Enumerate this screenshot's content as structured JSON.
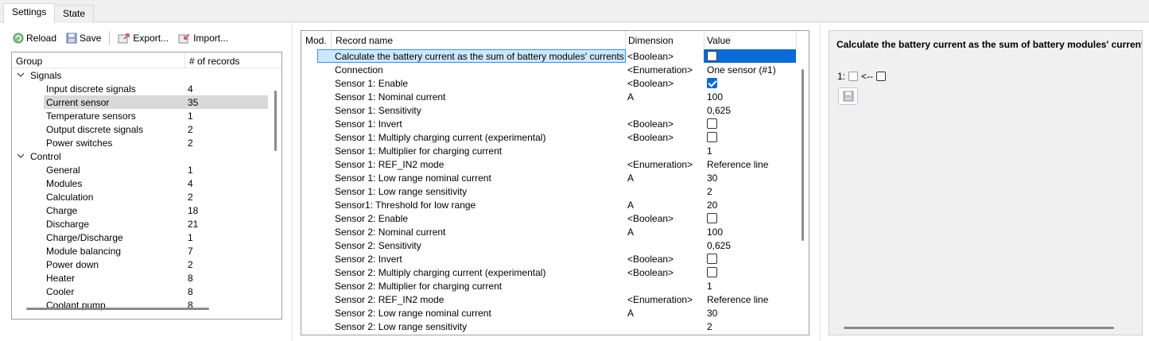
{
  "tabs": [
    {
      "label": "Settings"
    },
    {
      "label": "State"
    }
  ],
  "toolbar": {
    "reload_label": "Reload",
    "save_label": "Save",
    "export_label": "Export...",
    "import_label": "Import..."
  },
  "groups": {
    "header_group": "Group",
    "header_count": "# of records",
    "sections": [
      {
        "label": "Signals",
        "items": [
          {
            "label": "Input discrete signals",
            "count": "4"
          },
          {
            "label": "Current sensor",
            "count": "35",
            "selected": true
          },
          {
            "label": "Temperature sensors",
            "count": "1"
          },
          {
            "label": "Output discrete signals",
            "count": "2"
          },
          {
            "label": "Power switches",
            "count": "2"
          }
        ]
      },
      {
        "label": "Control",
        "items": [
          {
            "label": "General",
            "count": "1"
          },
          {
            "label": "Modules",
            "count": "4"
          },
          {
            "label": "Calculation",
            "count": "2"
          },
          {
            "label": "Charge",
            "count": "18"
          },
          {
            "label": "Discharge",
            "count": "21"
          },
          {
            "label": "Charge/Discharge",
            "count": "1"
          },
          {
            "label": "Module balancing",
            "count": "7"
          },
          {
            "label": "Power down",
            "count": "2"
          },
          {
            "label": "Heater",
            "count": "8"
          },
          {
            "label": "Cooler",
            "count": "8"
          },
          {
            "label": "Coolant pump",
            "count": "8"
          }
        ]
      }
    ]
  },
  "records": {
    "headers": {
      "mod": "Mod.",
      "name": "Record name",
      "dimension": "Dimension",
      "value": "Value"
    },
    "rows": [
      {
        "name": "Calculate the battery current as the sum of battery modules' currents",
        "dim": "<Boolean>",
        "type": "checkbox",
        "checked": false,
        "selected": true
      },
      {
        "name": "Connection",
        "dim": "<Enumeration>",
        "type": "text",
        "value": "One sensor (#1)"
      },
      {
        "name": "Sensor 1: Enable",
        "dim": "<Boolean>",
        "type": "checkbox",
        "checked": true
      },
      {
        "name": "Sensor 1: Nominal current",
        "dim": "A",
        "type": "text",
        "value": "100"
      },
      {
        "name": "Sensor 1: Sensitivity",
        "dim": "",
        "type": "text",
        "value": "0,625"
      },
      {
        "name": "Sensor 1: Invert",
        "dim": "<Boolean>",
        "type": "checkbox",
        "checked": false
      },
      {
        "name": "Sensor 1: Multiply charging current (experimental)",
        "dim": "<Boolean>",
        "type": "checkbox",
        "checked": false
      },
      {
        "name": "Sensor 1: Multiplier for charging current",
        "dim": "",
        "type": "text",
        "value": "1"
      },
      {
        "name": "Sensor 1: REF_IN2 mode",
        "dim": "<Enumeration>",
        "type": "text",
        "value": "Reference line"
      },
      {
        "name": "Sensor 1: Low range nominal current",
        "dim": "A",
        "type": "text",
        "value": "30"
      },
      {
        "name": "Sensor 1: Low range sensitivity",
        "dim": "",
        "type": "text",
        "value": "2"
      },
      {
        "name": "Sensor1: Threshold for low range",
        "dim": "A",
        "type": "text",
        "value": "20"
      },
      {
        "name": "Sensor 2: Enable",
        "dim": "<Boolean>",
        "type": "checkbox",
        "checked": false
      },
      {
        "name": "Sensor 2: Nominal current",
        "dim": "A",
        "type": "text",
        "value": "100"
      },
      {
        "name": "Sensor 2: Sensitivity",
        "dim": "",
        "type": "text",
        "value": "0,625"
      },
      {
        "name": "Sensor 2: Invert",
        "dim": "<Boolean>",
        "type": "checkbox",
        "checked": false
      },
      {
        "name": "Sensor 2: Multiply charging current (experimental)",
        "dim": "<Boolean>",
        "type": "checkbox",
        "checked": false
      },
      {
        "name": "Sensor 2: Multiplier for charging current",
        "dim": "",
        "type": "text",
        "value": "1"
      },
      {
        "name": "Sensor 2: REF_IN2 mode",
        "dim": "<Enumeration>",
        "type": "text",
        "value": "Reference line"
      },
      {
        "name": "Sensor 2: Low range nominal current",
        "dim": "A",
        "type": "text",
        "value": "30"
      },
      {
        "name": "Sensor 2: Low range sensitivity",
        "dim": "",
        "type": "text",
        "value": "2"
      }
    ]
  },
  "detail": {
    "title": "Calculate the battery current as the sum of battery modules' currents",
    "row_index": "1:",
    "arrow": "<--"
  },
  "colors": {
    "accent": "#0a6ad6",
    "selection_light": "#cce8ff",
    "selection_border": "#3390ff",
    "tree_selection": "#d9d9d9"
  }
}
